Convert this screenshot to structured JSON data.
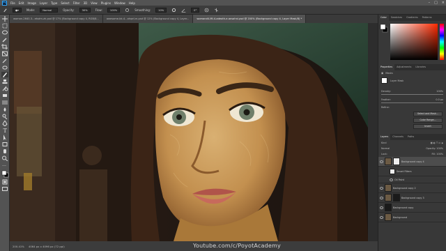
{
  "app": {
    "logo": "Ps"
  },
  "menu": [
    "File",
    "Edit",
    "Image",
    "Layer",
    "Type",
    "Select",
    "Filter",
    "3D",
    "View",
    "Plugins",
    "Window",
    "Help"
  ],
  "options": {
    "mode_label": "Mode:",
    "mode_value": "Normal",
    "opacity_label": "Opacity:",
    "opacity_value": "30%",
    "flow_label": "Flow:",
    "flow_value": "100%",
    "smoothing_label": "Smoothing:",
    "smoothing_value": "10%",
    "angle_value": "0°"
  },
  "tabs": [
    {
      "label": "woman-2640-3...etsdm-zh.psd @ 17% (Background copy 4, RGB/8...",
      "active": false
    },
    {
      "label": "awesome-bk-4...ahqel-m.psd @ 12% (Background copy 4, Layer...",
      "active": false
    },
    {
      "label": "womand4-MI-4-adeoth-e-ansahni.psd @ 200% (Background copy 4, Layer Mask/8) *",
      "active": true
    }
  ],
  "status": {
    "zoom": "200.41%",
    "doc": "4064 px x 4096 px (72 ppi)"
  },
  "watermark": "Youtube.com/c/PoyotAcademy",
  "color_panel": {
    "tabs": [
      "Color",
      "Swatches",
      "Gradients",
      "Patterns"
    ]
  },
  "properties": {
    "tabs": [
      "Properties",
      "Adjustments",
      "Libraries"
    ],
    "type": "Masks",
    "mask_label": "Layer Mask",
    "density_label": "Density:",
    "density_value": "100%",
    "feather_label": "Feather:",
    "feather_value": "0.0 px",
    "refine_label": "Refine:",
    "buttons": [
      "Select and Mask...",
      "Color Range...",
      "Invert"
    ]
  },
  "layers_panel": {
    "tabs": [
      "Layers",
      "Channels",
      "Paths"
    ],
    "kind_label": "Kind",
    "blend": "Normal",
    "opacity_label": "Opacity:",
    "opacity_value": "100%",
    "lock_label": "Lock:",
    "fill_label": "Fill:",
    "fill_value": "100%",
    "layers": [
      {
        "name": "Background copy 4",
        "selected": true,
        "thumb": "photo",
        "mask": true
      },
      {
        "name": "Smart Filters",
        "selected": false,
        "thumb": "mask",
        "mask": false
      },
      {
        "name": "Oil Paint",
        "selected": false,
        "thumb": "none",
        "mask": false
      },
      {
        "name": "Background copy 2",
        "selected": false,
        "thumb": "photo",
        "mask": false
      },
      {
        "name": "Background copy 3",
        "selected": false,
        "thumb": "photo",
        "mask": true
      },
      {
        "name": "Background copy",
        "selected": false,
        "thumb": "dark",
        "mask": false
      },
      {
        "name": "Background",
        "selected": false,
        "thumb": "photo",
        "mask": false
      }
    ]
  }
}
